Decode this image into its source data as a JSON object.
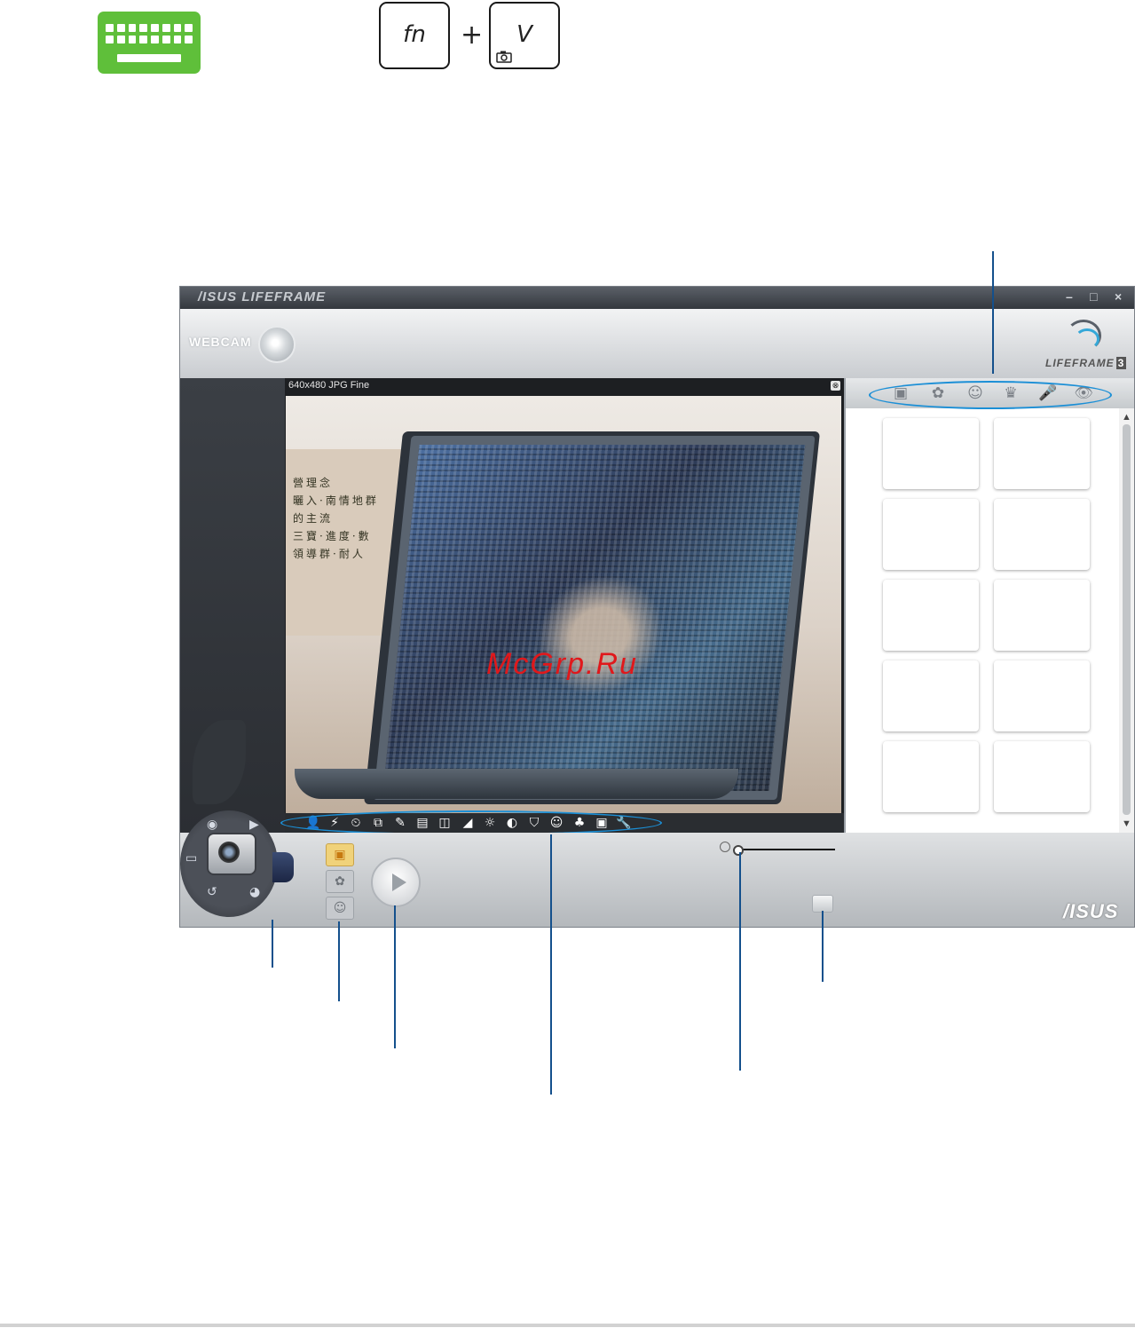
{
  "shortcut": {
    "key1": "fn",
    "plus": "+",
    "key2": "V",
    "icon": "keyboard-icon",
    "key2_subicon": "camera-icon"
  },
  "window": {
    "brand": "/ISUS LIFEFRAME",
    "controls": [
      "–",
      "□",
      "×"
    ],
    "mode_label": "WEBCAM",
    "logo_text": "LIFEFRAME",
    "logo_num": "3"
  },
  "preview": {
    "info": "640x480 JPG Fine",
    "close": "⊗",
    "signage_lines": [
      "營理念",
      "曬入·南情地群",
      "的主流",
      "三寶·進度·數",
      "領導群·耐人"
    ],
    "watermark": "McGrp.Ru"
  },
  "toolbar_icons": [
    "👤",
    "⚡",
    "⏲",
    "⧉",
    "✎",
    "▤",
    "◫",
    "◢",
    "☼",
    "◐",
    "⛉",
    "☺",
    "♣",
    "▣",
    "🔧"
  ],
  "effect_tabs": [
    "▣",
    "✿",
    "☺",
    "♛",
    "🎤",
    "👁"
  ],
  "thumbnails_count": 10,
  "bottom": {
    "modes": [
      "▣",
      "✿",
      "☺"
    ],
    "brand": "/ISUS"
  },
  "colors": {
    "callout": "#14508c",
    "highlight_oval": "#1b8fd6",
    "keyboard_green": "#5fbf3a",
    "watermark": "#e0181b"
  }
}
